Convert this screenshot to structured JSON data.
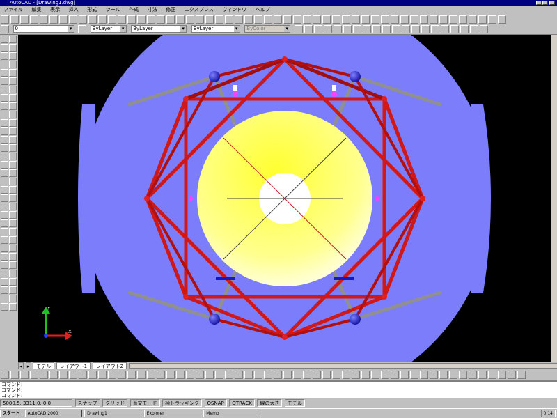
{
  "window": {
    "title": "AutoCAD - [Drawing1.dwg]",
    "accent_color": "#000080"
  },
  "menu": [
    "ファイル",
    "編集",
    "表示",
    "挿入",
    "形式",
    "ツール",
    "作成",
    "寸法",
    "修正",
    "エクスプレス",
    "ウィンドウ",
    "ヘルプ"
  ],
  "properties_bar": {
    "layer_value": "0",
    "color_value": "ByLayer",
    "linetype_value": "ByLayer",
    "lineweight_value": "ByLayer",
    "plotstyle_value": "ByColor"
  },
  "layout_tabs": [
    "モデル",
    "レイアウト1",
    "レイアウト2"
  ],
  "command_lines": [
    "コマンド:",
    "コマンド:",
    "コマンド:"
  ],
  "status": {
    "coordinates": "5000.5, 3311.0, 0.0",
    "toggles": [
      "スナップ",
      "グリッド",
      "直交モード",
      "極トラッキング",
      "OSNAP",
      "OTRACK",
      "線の太さ",
      "モデル"
    ]
  },
  "taskbar": {
    "start_label": "スタート",
    "tasks": [
      "AutoCAD 2000",
      "Drawing1",
      "Explorer",
      "Memo"
    ],
    "clock": "0:14"
  },
  "drawing": {
    "background_color": "#000000",
    "base_color": "#7b7dfb",
    "frame_color": "#e02020",
    "disk_color": "#ffff40",
    "node_color": "#2a2ad0"
  }
}
